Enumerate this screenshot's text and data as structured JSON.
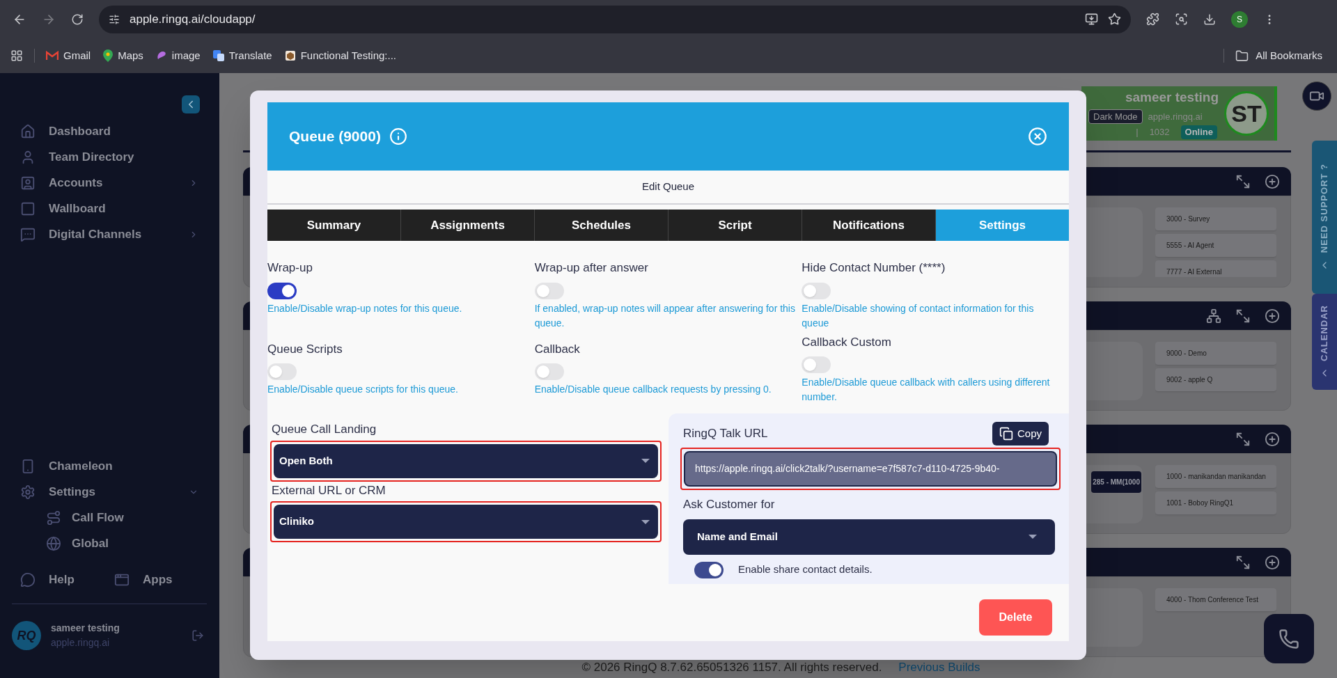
{
  "browser": {
    "url": "apple.ringq.ai/cloudapp/",
    "profile_initial": "S",
    "all_bookmarks": "All Bookmarks",
    "bookmarks": [
      {
        "label": "Gmail"
      },
      {
        "label": "Maps"
      },
      {
        "label": "image"
      },
      {
        "label": "Translate"
      },
      {
        "label": "Functional Testing:..."
      }
    ]
  },
  "sidebar": {
    "items": [
      {
        "label": "Dashboard",
        "has_submenu": false
      },
      {
        "label": "Team Directory",
        "has_submenu": false
      },
      {
        "label": "Accounts",
        "has_submenu": true
      },
      {
        "label": "Wallboard",
        "has_submenu": false
      },
      {
        "label": "Digital Channels",
        "has_submenu": true
      }
    ],
    "lower_items": [
      {
        "label": "Chameleon"
      },
      {
        "label": "Settings",
        "expanded": true,
        "children": [
          {
            "label": "Call Flow"
          },
          {
            "label": "Global"
          }
        ]
      }
    ],
    "help": "Help",
    "apps": "Apps",
    "user": {
      "name": "sameer testing",
      "domain": "apple.ringq.ai",
      "initials": "RQ"
    }
  },
  "profile_card": {
    "name": "sameer testing",
    "mode_button": "Dark Mode",
    "domain": "apple.ringq.ai",
    "separator": "|",
    "extension": "1032",
    "status": "Online",
    "initials": "ST"
  },
  "side_tabs": [
    {
      "label": "NEED SUPPORT ?"
    },
    {
      "label": "CALENDAR"
    }
  ],
  "panels": [
    {
      "tree_button": false,
      "items": [
        "3000 - Survey",
        "5555 - AI Agent",
        "7777 - AI External"
      ]
    },
    {
      "tree_button": true,
      "items": [
        "9000 - Demo",
        "9002 - apple Q"
      ]
    },
    {
      "tree_button": false,
      "chip": "285 - MM(1000",
      "items": [
        "1000 - manikandan manikandan",
        "1001 - Boboy RingQ1"
      ]
    },
    {
      "tree_button": false,
      "items": [
        "4000 - Thom Conference Test"
      ]
    }
  ],
  "modal": {
    "title": "Queue (9000)",
    "subtitle": "Edit Queue",
    "tabs": [
      {
        "label": "Summary",
        "selected": false
      },
      {
        "label": "Assignments",
        "selected": false
      },
      {
        "label": "Schedules",
        "selected": false
      },
      {
        "label": "Script",
        "selected": false
      },
      {
        "label": "Notifications",
        "selected": false
      },
      {
        "label": "Settings",
        "selected": true
      }
    ],
    "settings": [
      {
        "label": "Wrap-up",
        "on": true,
        "description": "Enable/Disable wrap-up notes for this queue."
      },
      {
        "label": "Wrap-up after answer",
        "on": false,
        "description": "If enabled, wrap-up notes will appear after answering for this queue."
      },
      {
        "label": "Hide Contact Number (****)",
        "on": false,
        "description": "Enable/Disable showing of contact information for this queue"
      },
      {
        "label": "Queue Scripts",
        "on": false,
        "description": "Enable/Disable queue scripts for this queue."
      },
      {
        "label": "Callback",
        "on": false,
        "description": "Enable/Disable queue callback requests by pressing 0."
      },
      {
        "label": "Callback Custom",
        "on": false,
        "description": "Enable/Disable queue callback with callers using different number."
      }
    ],
    "selects": [
      {
        "label": "Queue Call Landing",
        "value": "Open Both",
        "highlighted": true
      },
      {
        "label": "External URL or CRM",
        "value": "Cliniko",
        "highlighted": true
      }
    ],
    "talk_url": {
      "label": "RingQ Talk URL",
      "copy_button": "Copy",
      "value": "https://apple.ringq.ai/click2talk/?username=e7f587c7-d110-4725-9b40-",
      "highlighted": true
    },
    "ask_customer": {
      "label": "Ask Customer for",
      "value": "Name and Email"
    },
    "share_contact": {
      "label": "Enable share contact details.",
      "on": true
    },
    "delete_button": "Delete"
  },
  "footer": {
    "copyright": "© 2026 RingQ 8.7.62.65051326 1157. All rights reserved.",
    "link": "Previous Builds"
  }
}
